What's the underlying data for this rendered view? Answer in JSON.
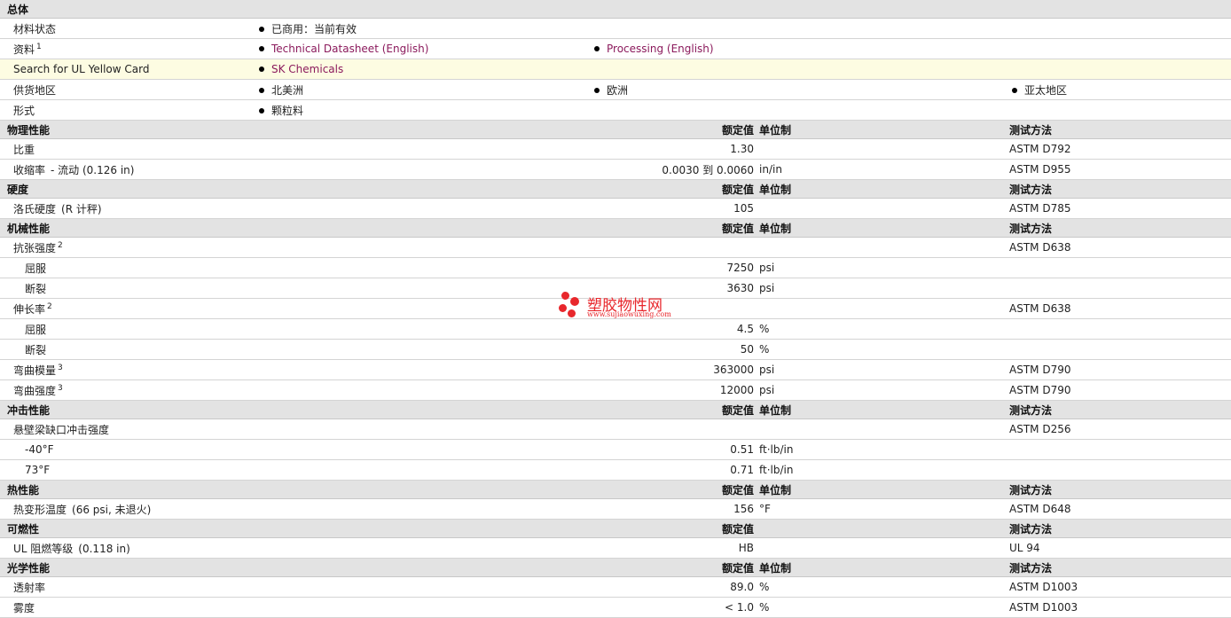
{
  "general": {
    "title": "总体",
    "status_label": "材料状态",
    "status_value": "已商用：当前有效",
    "docs_label": "资料",
    "docs_sup": "1",
    "doc1": "Technical Datasheet (English)",
    "doc2": "Processing (English)",
    "ul_label": "Search for UL Yellow Card",
    "ul_value": "SK Chemicals",
    "region_label": "供货地区",
    "regions": [
      "北美洲",
      "欧洲",
      "亚太地区"
    ],
    "form_label": "形式",
    "form_value": "颗粒料"
  },
  "headers": {
    "nominal": "额定值",
    "unit": "单位制",
    "method": "测试方法"
  },
  "physical": {
    "title": "物理性能",
    "rows": [
      {
        "name": "比重",
        "cond": "",
        "value": "1.30",
        "unit": "",
        "method": "ASTM D792"
      },
      {
        "name": "收缩率",
        "cond": "- 流动  (0.126 in)",
        "value": "0.0030 到  0.0060",
        "unit": "in/in",
        "method": "ASTM D955"
      }
    ]
  },
  "hardness": {
    "title": "硬度",
    "rows": [
      {
        "name": "洛氏硬度",
        "cond": "(R 计秤)",
        "value": "105",
        "unit": "",
        "method": "ASTM D785"
      }
    ]
  },
  "mechanical": {
    "title": "机械性能",
    "tensile": {
      "name": "抗张强度",
      "sup": "2",
      "method": "ASTM D638",
      "yield_label": "屈服",
      "yield_value": "7250",
      "yield_unit": "psi",
      "break_label": "断裂",
      "break_value": "3630",
      "break_unit": "psi"
    },
    "elong": {
      "name": "伸长率",
      "sup": "2",
      "method": "ASTM D638",
      "yield_label": "屈服",
      "yield_value": "4.5",
      "yield_unit": "%",
      "break_label": "断裂",
      "break_value": "50",
      "break_unit": "%"
    },
    "flexmod": {
      "name": "弯曲模量",
      "sup": "3",
      "value": "363000",
      "unit": "psi",
      "method": "ASTM D790"
    },
    "flexstr": {
      "name": "弯曲强度",
      "sup": "3",
      "value": "12000",
      "unit": "psi",
      "method": "ASTM D790"
    }
  },
  "impact": {
    "title": "冲击性能",
    "izod": {
      "name": "悬壁梁缺口冲击强度",
      "method": "ASTM D256",
      "t1_label": "-40°F",
      "t1_value": "0.51",
      "t1_unit": "ft·lb/in",
      "t2_label": "73°F",
      "t2_value": "0.71",
      "t2_unit": "ft·lb/in"
    }
  },
  "thermal": {
    "title": "热性能",
    "hdt": {
      "name": "热变形温度",
      "cond": "(66 psi, 未退火)",
      "value": "156",
      "unit": "°F",
      "method": "ASTM D648"
    }
  },
  "flammability": {
    "title": "可燃性",
    "ul": {
      "name": "UL 阻燃等级",
      "cond": "(0.118 in)",
      "value": "HB",
      "method": "UL 94"
    }
  },
  "optical": {
    "title": "光学性能",
    "trans": {
      "name": "透射率",
      "value": "89.0",
      "unit": "%",
      "method": "ASTM D1003"
    },
    "haze": {
      "name": "雾度",
      "value": "< 1.0",
      "unit": "%",
      "method": "ASTM D1003"
    }
  },
  "watermark": {
    "title": "塑胶物性网",
    "url": "www.sujiaowuxing.com",
    "color": "#e8272c"
  }
}
